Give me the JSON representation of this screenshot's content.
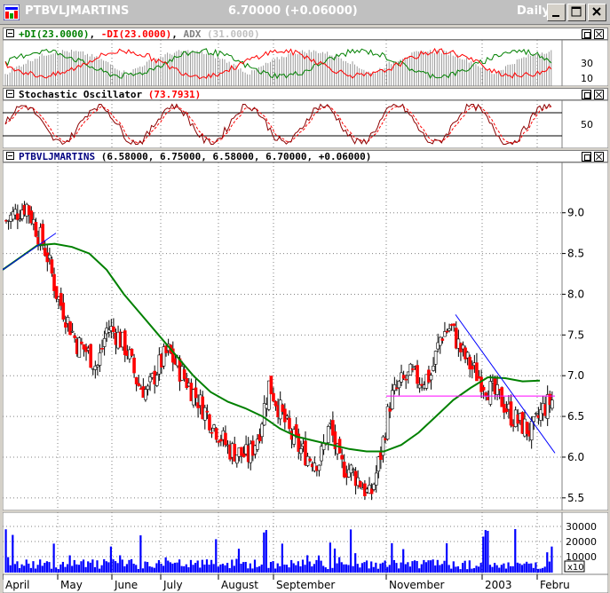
{
  "window": {
    "symbol": "PTBVLJMARTINS",
    "price_text": "6.70000 (+0.06000)",
    "period": "Daily",
    "buttons": [
      "minimize",
      "maximize",
      "close"
    ]
  },
  "panes": {
    "dmi": {
      "name": "+DI",
      "plus_di": "(23.0000)",
      "minus_di_label": "-DI",
      "minus_di": "(23.0000)",
      "adx_label": "ADX",
      "adx": "(31.0000)",
      "ticks": [
        "30",
        "10"
      ]
    },
    "stochastic": {
      "name": "Stochastic Oscillator",
      "value": "(73.7931)",
      "ticks": [
        "50"
      ]
    },
    "price": {
      "symbol": "PTBVLJMARTINS",
      "ohlc": "(6.58000, 6.75000, 6.58000, 6.70000, +0.06000)",
      "ticks": [
        "9.0",
        "8.5",
        "8.0",
        "7.5",
        "7.0",
        "6.5",
        "6.0",
        "5.5"
      ]
    },
    "volume": {
      "ticks": [
        "30000",
        "20000",
        "10000"
      ],
      "multiplier": "x10"
    }
  },
  "x_axis": {
    "months": [
      "April",
      "May",
      "June",
      "July",
      "August",
      "September",
      "November",
      "2003",
      "Febru"
    ]
  },
  "colors": {
    "plus_di": "#008000",
    "minus_di": "#ff0000",
    "adx": "#808080",
    "stoch_k": "#8b0000",
    "stoch_d": "#ff0000",
    "ma": "#008000",
    "trend": "#0000ff",
    "support": "#ff00ff",
    "volume": "#0000ff",
    "grid": "#808080",
    "title_bar": "#c0c0c0"
  },
  "chart_data": {
    "type": "candlestick",
    "series": [
      {
        "name": "price_close",
        "values": [
          8.9,
          9.0,
          9.1,
          8.8,
          8.5,
          8.0,
          7.7,
          7.4,
          7.3,
          7.1,
          7.6,
          7.5,
          7.3,
          6.9,
          6.8,
          7.1,
          7.3,
          7.1,
          6.9,
          6.7,
          6.5,
          6.3,
          6.1,
          6.05,
          6.0,
          6.3,
          6.9,
          6.6,
          6.3,
          6.1,
          6.0,
          5.95,
          6.4,
          5.9,
          5.85,
          5.7,
          5.5,
          6.0,
          6.7,
          6.9,
          7.0,
          6.95,
          7.0,
          7.5,
          7.6,
          7.3,
          7.1,
          6.95,
          6.8,
          6.7,
          6.5,
          6.4,
          6.3,
          6.58,
          6.7
        ]
      },
      {
        "name": "moving_average",
        "values": [
          8.3,
          8.45,
          8.6,
          8.62,
          8.58,
          8.5,
          8.3,
          8.0,
          7.75,
          7.5,
          7.25,
          7.0,
          6.8,
          6.68,
          6.6,
          6.5,
          6.35,
          6.25,
          6.2,
          6.15,
          6.1,
          6.07,
          6.07,
          6.15,
          6.3,
          6.5,
          6.7,
          6.85,
          6.98,
          6.97,
          6.93,
          6.94
        ]
      }
    ],
    "support_level": 6.75,
    "ylim": [
      5.4,
      9.4
    ]
  }
}
